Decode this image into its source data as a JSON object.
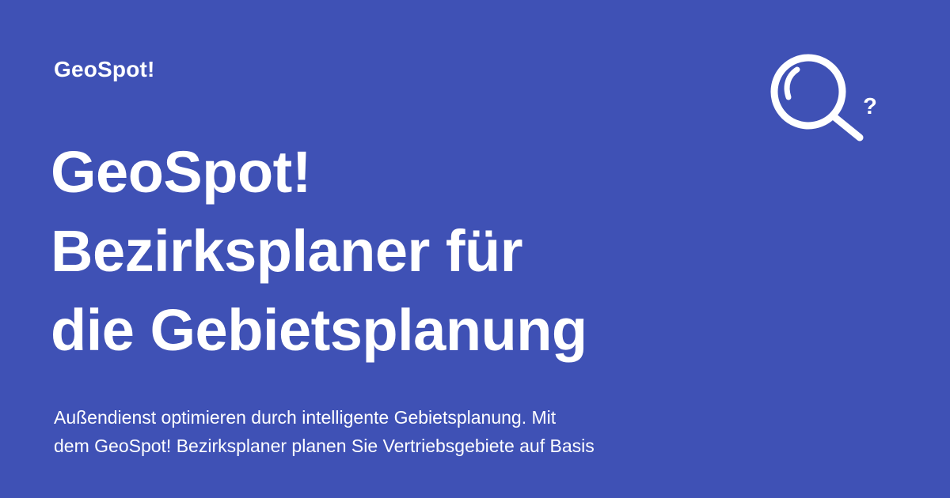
{
  "brand": {
    "name": "GeoSpot!"
  },
  "hero": {
    "title_lines": [
      "GeoSpot!",
      "Bezirksplaner für",
      "die Gebietsplanung"
    ],
    "description_lines": [
      "Außendienst optimieren durch intelligente Gebietsplanung. Mit",
      "dem GeoSpot! Bezirksplaner planen Sie Vertriebsgebiete auf Basis"
    ]
  },
  "icon": {
    "name": "search-help-icon",
    "glyph": "?"
  },
  "colors": {
    "background": "#3f51b5",
    "foreground": "#ffffff"
  }
}
